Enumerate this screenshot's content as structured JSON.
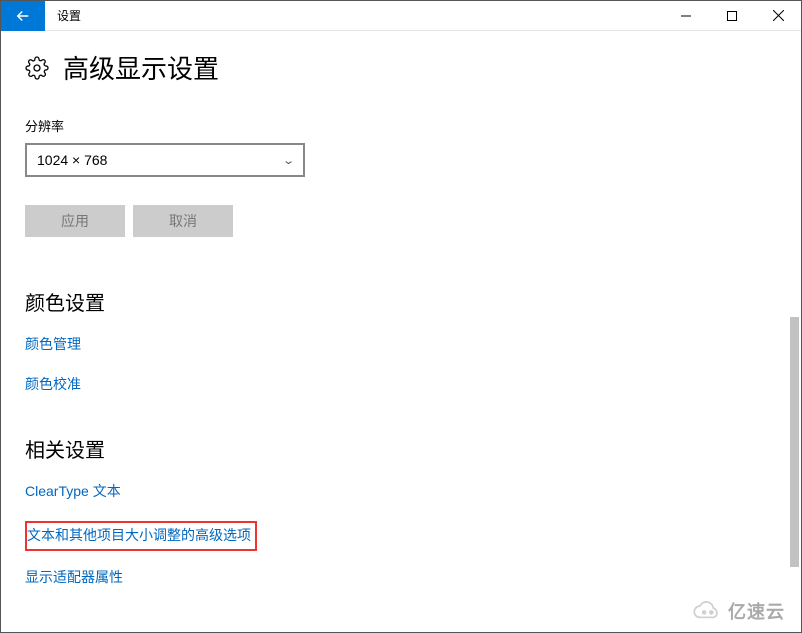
{
  "app": {
    "title": "设置"
  },
  "page": {
    "title": "高级显示设置"
  },
  "resolution": {
    "label": "分辨率",
    "value": "1024 × 768"
  },
  "buttons": {
    "apply": "应用",
    "cancel": "取消"
  },
  "color_section": {
    "title": "颜色设置",
    "links": {
      "management": "颜色管理",
      "calibration": "颜色校准"
    }
  },
  "related_section": {
    "title": "相关设置",
    "links": {
      "cleartype": "ClearType 文本",
      "advanced_sizing": "文本和其他项目大小调整的高级选项",
      "adapter_properties": "显示适配器属性"
    }
  },
  "watermark": "亿速云"
}
